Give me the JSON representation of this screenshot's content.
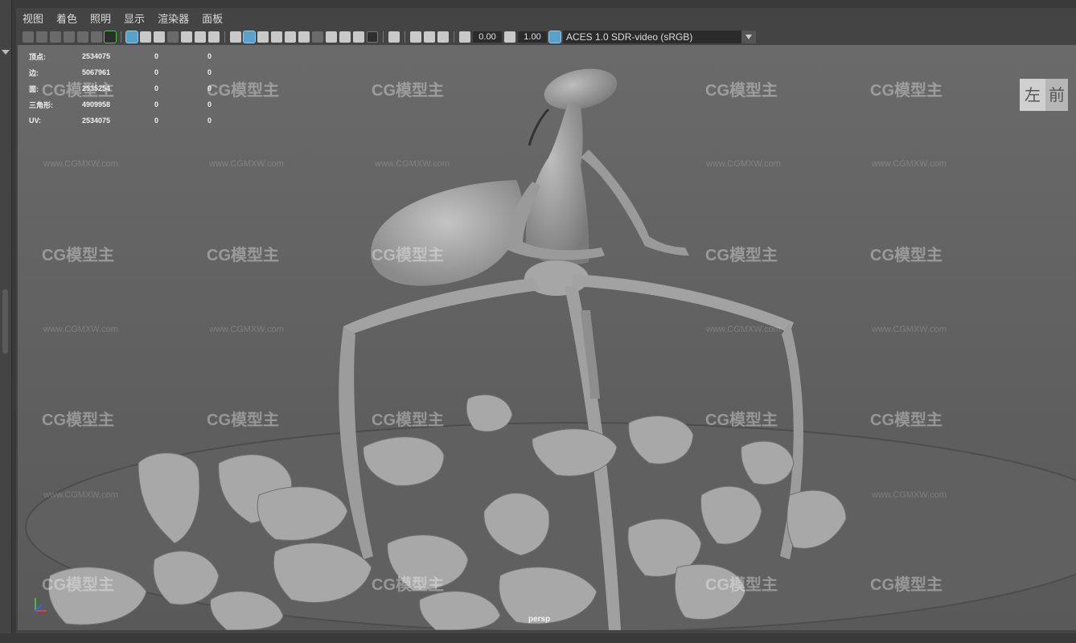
{
  "menu": [
    "视图",
    "着色",
    "照明",
    "显示",
    "渲染器",
    "面板"
  ],
  "toolbar": {
    "exposure": "0.00",
    "gamma": "1.00",
    "colorspace": "ACES 1.0 SDR-video (sRGB)"
  },
  "hud": {
    "rows": [
      {
        "label": "顶点:",
        "value": "2534075",
        "a": "0",
        "b": "0"
      },
      {
        "label": "边:",
        "value": "5067961",
        "a": "0",
        "b": "0"
      },
      {
        "label": "面:",
        "value": "2535254",
        "a": "0",
        "b": "0"
      },
      {
        "label": "三角形:",
        "value": "4909958",
        "a": "0",
        "b": "0"
      },
      {
        "label": "UV:",
        "value": "2534075",
        "a": "0",
        "b": "0"
      }
    ]
  },
  "viewcube": {
    "left": "左",
    "front": "前"
  },
  "camera": "persp",
  "watermark": {
    "logo": "CG模型主",
    "url": "www.CGMXW.com"
  },
  "colors": {
    "accent": "#5aa0c8",
    "viewport": "#666666"
  }
}
